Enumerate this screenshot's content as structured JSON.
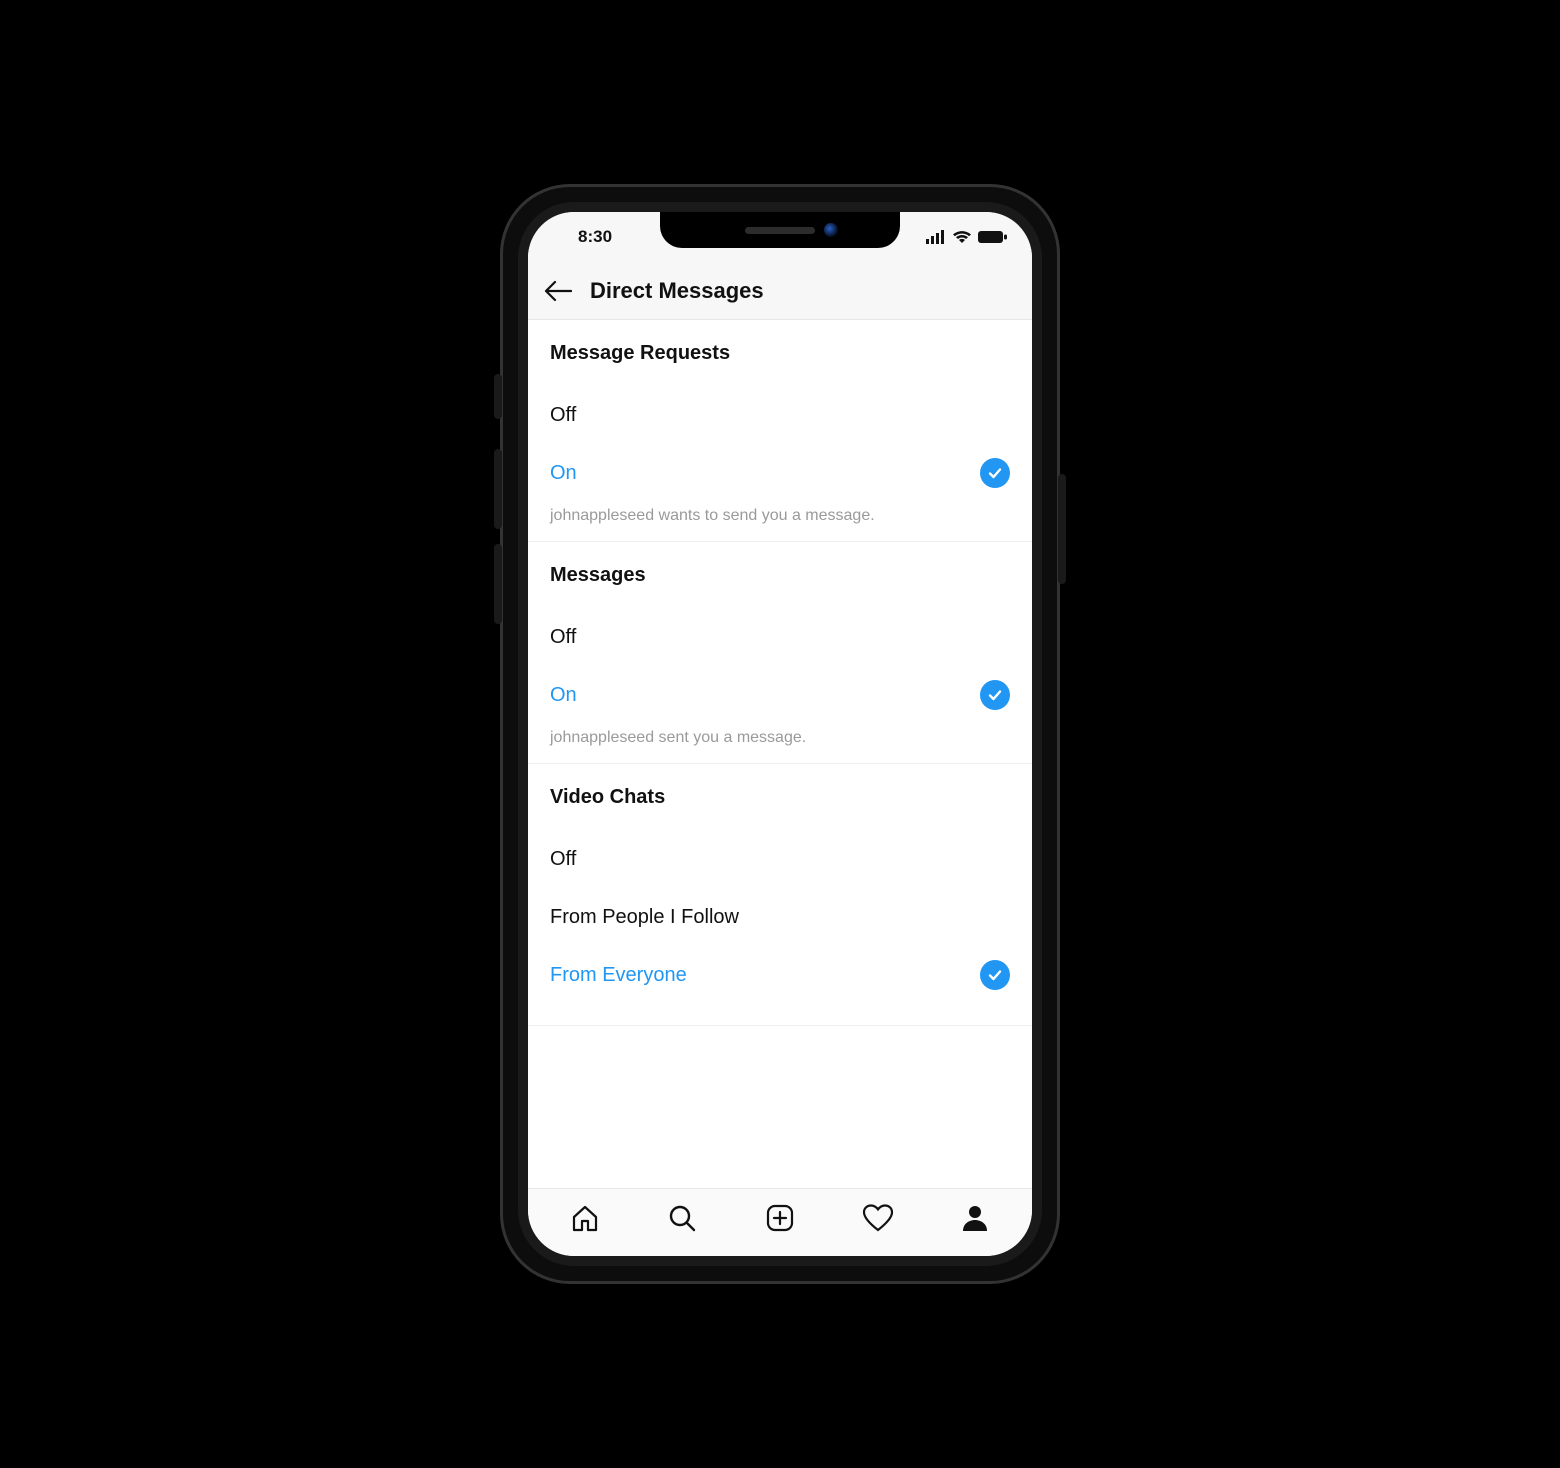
{
  "status": {
    "time": "8:30"
  },
  "header": {
    "title": "Direct Messages"
  },
  "sections": {
    "message_requests": {
      "title": "Message Requests",
      "off": "Off",
      "on": "On",
      "sub": "johnappleseed wants to send you a message."
    },
    "messages": {
      "title": "Messages",
      "off": "Off",
      "on": "On",
      "sub": "johnappleseed sent you a message."
    },
    "video_chats": {
      "title": "Video Chats",
      "off": "Off",
      "follow": "From People I Follow",
      "everyone": "From Everyone"
    }
  }
}
